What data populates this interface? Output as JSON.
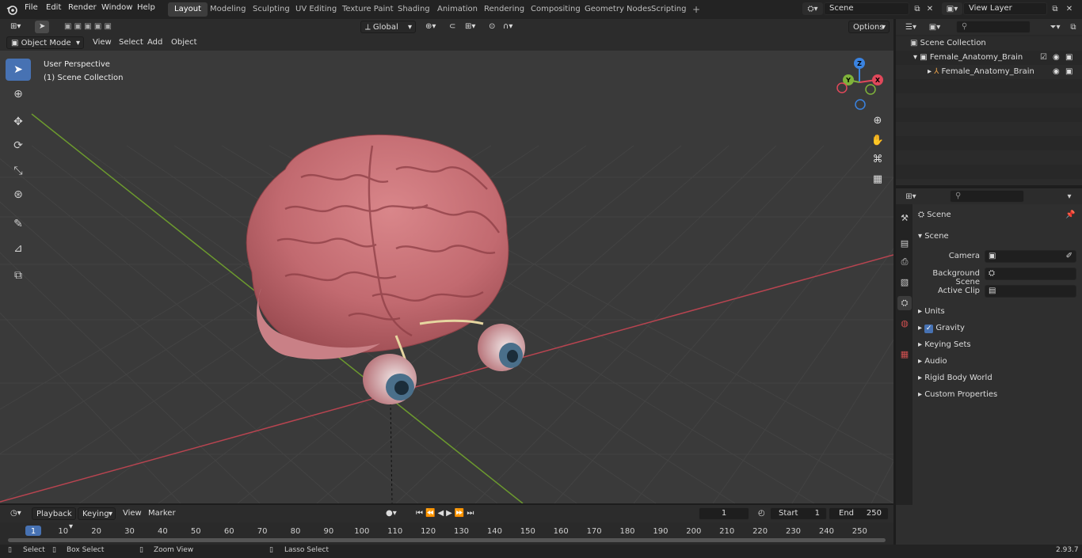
{
  "menubar": {
    "items": [
      "File",
      "Edit",
      "Render",
      "Window",
      "Help"
    ],
    "workspaces": [
      "Layout",
      "Modeling",
      "Sculpting",
      "UV Editing",
      "Texture Paint",
      "Shading",
      "Animation",
      "Rendering",
      "Compositing",
      "Geometry Nodes",
      "Scripting"
    ],
    "active_workspace": "Layout",
    "add_tab": "+",
    "scene_name": "Scene",
    "view_layer": "View Layer"
  },
  "viewport_header": {
    "mode": "Object Mode",
    "menus": [
      "View",
      "Select",
      "Add",
      "Object"
    ],
    "transform_orientation": "Global",
    "options": "Options"
  },
  "viewport": {
    "perspective_label": "User Perspective",
    "collection_label": "(1) Scene Collection",
    "axes": {
      "x": "X",
      "y": "Y",
      "z": "Z"
    },
    "colors": {
      "x_axis": "#e0485a",
      "y_axis": "#7fb33a",
      "z_axis": "#3a83e0",
      "grid_bg": "#3a3a3a"
    }
  },
  "outliner": {
    "root": "Scene Collection",
    "items": [
      {
        "label": "Female_Anatomy_Brain",
        "type": "collection"
      },
      {
        "label": "Female_Anatomy_Brain",
        "type": "object"
      }
    ]
  },
  "properties": {
    "context": "Scene",
    "panel_title": "Scene",
    "fields": [
      {
        "label": "Camera"
      },
      {
        "label": "Background Scene"
      },
      {
        "label": "Active Clip"
      }
    ],
    "sections": [
      "Units",
      "Gravity",
      "Keying Sets",
      "Audio",
      "Rigid Body World",
      "Custom Properties"
    ],
    "gravity_checked": true
  },
  "timeline": {
    "menus": [
      "Playback",
      "Keying",
      "View",
      "Marker"
    ],
    "current_frame": "1",
    "start_label": "Start",
    "start_value": "1",
    "end_label": "End",
    "end_value": "250",
    "ruler": [
      "1",
      "10",
      "20",
      "30",
      "40",
      "50",
      "60",
      "70",
      "80",
      "90",
      "100",
      "110",
      "120",
      "130",
      "140",
      "150",
      "160",
      "170",
      "180",
      "190",
      "200",
      "210",
      "220",
      "230",
      "240",
      "250"
    ]
  },
  "statusbar": {
    "select": "Select",
    "box_select": "Box Select",
    "zoom_view": "Zoom View",
    "lasso_select": "Lasso Select",
    "version": "2.93.7"
  }
}
